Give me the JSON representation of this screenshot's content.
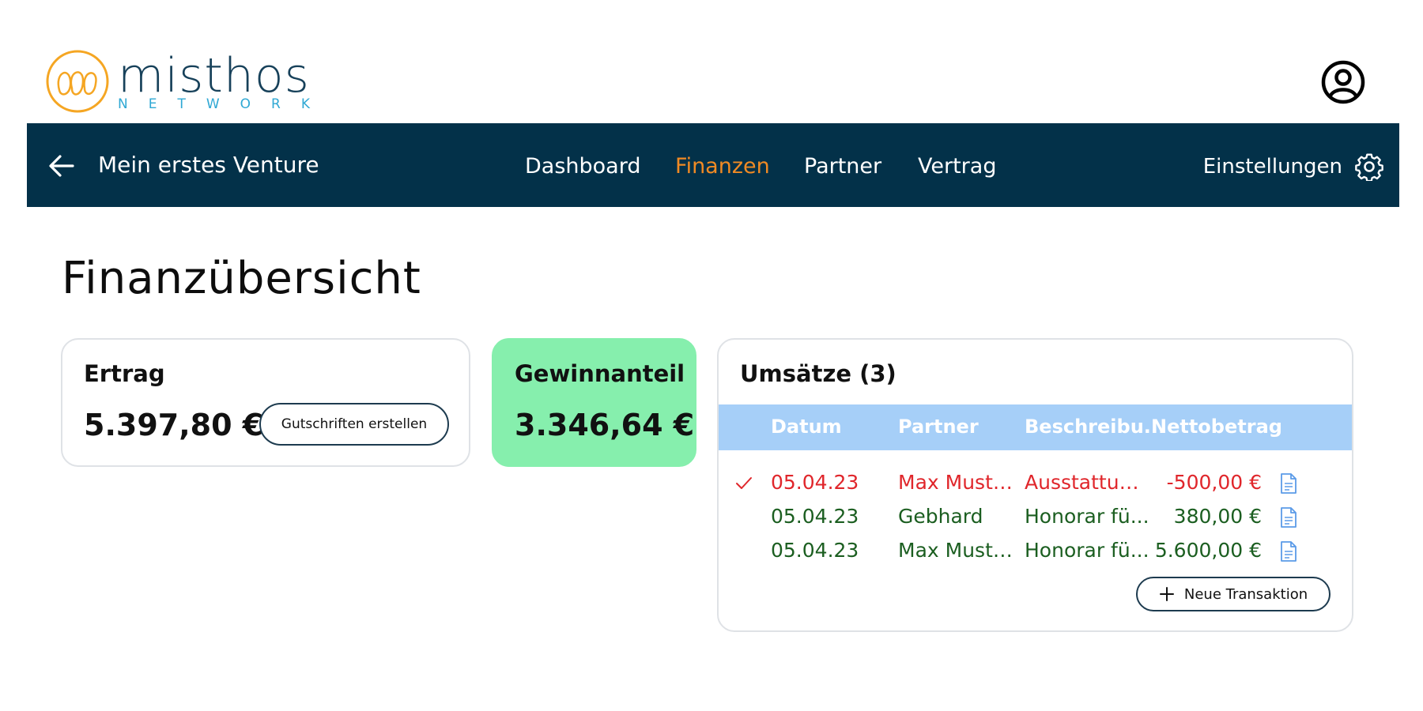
{
  "brand": {
    "name": "misthos",
    "subtitle": "NETWORK",
    "colors": {
      "logo_orange": "#f5a623",
      "logo_text": "#17415a",
      "logo_sub": "#2fa8d4"
    }
  },
  "header": {
    "profile_icon": "user-circle-icon"
  },
  "nav": {
    "back_icon": "arrow-left-icon",
    "venture_title": "Mein erstes Venture",
    "items": [
      {
        "label": "Dashboard",
        "active": false
      },
      {
        "label": "Finanzen",
        "active": true
      },
      {
        "label": "Partner",
        "active": false
      },
      {
        "label": "Vertrag",
        "active": false
      }
    ],
    "settings_label": "Einstellungen",
    "settings_icon": "gear-icon",
    "colors": {
      "background": "#033149",
      "active": "#f08a24"
    }
  },
  "page": {
    "title": "Finanzübersicht"
  },
  "revenue_card": {
    "label": "Ertrag",
    "amount": "5.397,80 €",
    "button_label": "Gutschriften erstellen"
  },
  "profit_card": {
    "label": "Gewinnanteil",
    "amount": "3.346,64 €",
    "color": "#86efad"
  },
  "sales_card": {
    "title": "Umsätze (3)",
    "columns": [
      "Datum",
      "Partner",
      "Beschreibu...",
      "Nettobetrag"
    ],
    "header_color": "#a6cff8",
    "rows": [
      {
        "checked": true,
        "date": "05.04.23",
        "partner": "Max Muster...",
        "description": "Ausstattun...",
        "amount": "-500,00 €",
        "status": "negative"
      },
      {
        "checked": false,
        "date": "05.04.23",
        "partner": "Gebhard",
        "description": "Honorar fü...",
        "amount": "380,00 €",
        "status": "positive"
      },
      {
        "checked": false,
        "date": "05.04.23",
        "partner": "Max Muster...",
        "description": "Honorar fü...",
        "amount": "5.600,00 €",
        "status": "positive"
      }
    ],
    "row_colors": {
      "negative": "#e0262b",
      "positive": "#1b5e20"
    },
    "new_button_label": "Neue Transaktion",
    "new_button_icon": "plus-icon",
    "doc_icon": "document-icon"
  }
}
